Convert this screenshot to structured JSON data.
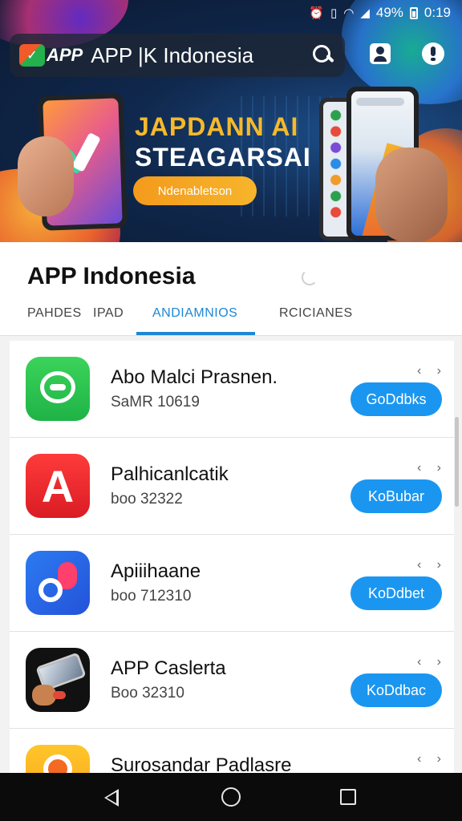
{
  "status_bar": {
    "battery_percent": "49%",
    "time": "0:19"
  },
  "banner": {
    "logo_text": "APP",
    "title": "APP |K Indonesia",
    "headline": "JAPDANN AI",
    "subheadline": "STEAGARSAI",
    "pill_label": "Ndenabletson"
  },
  "header": {
    "page_title": "APP Indonesia",
    "tabs": [
      {
        "label": "PAHDES",
        "active": false
      },
      {
        "label": "IPAD",
        "active": false
      },
      {
        "label": "ANDIAMNIOS",
        "active": true
      },
      {
        "label": "RCICIANES",
        "active": false
      }
    ]
  },
  "apps": [
    {
      "name": "Abo Malci Prasnen.",
      "meta": "SaMR 10619",
      "action": "GoDdbks",
      "icon": "chat-icon",
      "icon_color": "#24c04b"
    },
    {
      "name": "Palhicanlcatik",
      "meta": "boo 32322",
      "action": "KoBubar",
      "icon": "letter-a-icon",
      "icon_color": "#e8252c"
    },
    {
      "name": "Apiiihaane",
      "meta": "boo 712310",
      "action": "KoDdbet",
      "icon": "music-d-icon",
      "icon_color": "#2a6de6"
    },
    {
      "name": "APP Caslerta",
      "meta": "Boo 32310",
      "action": "KoDdbac",
      "icon": "phone-icon",
      "icon_color": "#111111"
    },
    {
      "name": "Surosandar Padlasre",
      "meta": "",
      "action": "",
      "icon": "orange-icon",
      "icon_color": "#f7b21f"
    }
  ],
  "colors": {
    "accent": "#1d87d6",
    "button": "#1a96f0",
    "banner_gold": "#f5b92b"
  }
}
